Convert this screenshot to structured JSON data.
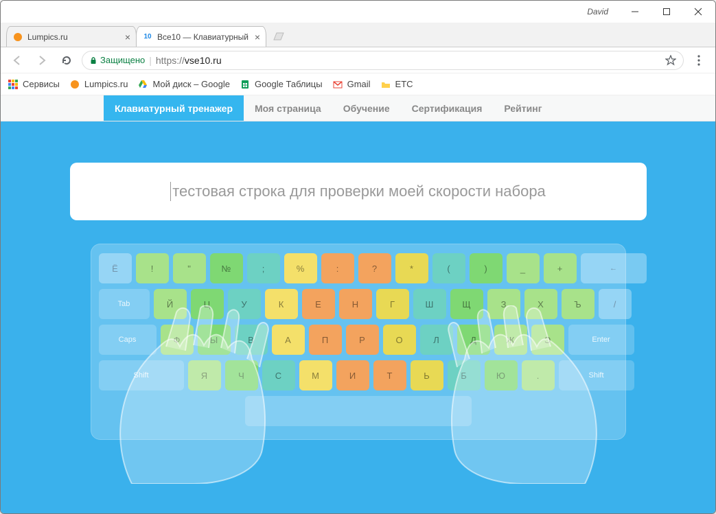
{
  "window": {
    "user": "David"
  },
  "tabs": [
    {
      "title": "Lumpics.ru",
      "active": false
    },
    {
      "title": "Все10 — Клавиатурный",
      "active": true
    }
  ],
  "address": {
    "secure_label": "Защищено",
    "scheme": "https://",
    "host": "vse10.ru"
  },
  "bookmarks": [
    {
      "label": "Сервисы"
    },
    {
      "label": "Lumpics.ru"
    },
    {
      "label": "Мой диск – Google"
    },
    {
      "label": "Google Таблицы"
    },
    {
      "label": "Gmail"
    },
    {
      "label": "ETC"
    }
  ],
  "sitenav": [
    {
      "label": "Клавиатурный тренажер",
      "active": true
    },
    {
      "label": "Моя страница"
    },
    {
      "label": "Обучение"
    },
    {
      "label": "Сертификация"
    },
    {
      "label": "Рейтинг"
    }
  ],
  "typing_text": "тестовая строка для проверки моей скорости набора",
  "keyboard": {
    "row1": [
      "Ё",
      "!",
      "\"",
      "№",
      ";",
      "%",
      ":",
      "?",
      "*",
      "(",
      ")",
      "_",
      "+",
      "←"
    ],
    "row2": [
      "Tab",
      "Й",
      "Ц",
      "У",
      "К",
      "Е",
      "Н",
      "Г",
      "Ш",
      "Щ",
      "З",
      "Х",
      "Ъ",
      "/"
    ],
    "row3": [
      "Caps",
      "Ф",
      "Ы",
      "В",
      "А",
      "П",
      "Р",
      "О",
      "Л",
      "Д",
      "Ж",
      "Э",
      "Enter"
    ],
    "row4": [
      "Shift",
      "Я",
      "Ч",
      "С",
      "М",
      "И",
      "Т",
      "Ь",
      "Б",
      "Ю",
      ".",
      "Shift"
    ]
  },
  "color_map": {
    "row1": [
      "gray",
      "c-green1",
      "c-green1",
      "c-green2",
      "c-teal",
      "c-yellow",
      "c-orange",
      "c-orange",
      "c-yellow2",
      "c-teal",
      "c-green2",
      "c-green1",
      "c-green1",
      "gray"
    ],
    "row2": [
      "clear",
      "c-green1",
      "c-green2",
      "c-teal",
      "c-yellow",
      "c-orange",
      "c-orange",
      "c-yellow2",
      "c-teal",
      "c-green2",
      "c-green1",
      "c-green1",
      "c-green1",
      "gray"
    ],
    "row3": [
      "clear",
      "c-green1",
      "c-green2",
      "c-teal",
      "c-yellow",
      "c-orange",
      "c-orange",
      "c-yellow2",
      "c-teal",
      "c-green2",
      "c-green1",
      "c-green1",
      "clear"
    ],
    "row4": [
      "clear",
      "c-green1",
      "c-green2",
      "c-teal",
      "c-yellow",
      "c-orange",
      "c-orange",
      "c-yellow2",
      "c-teal",
      "c-green2",
      "c-green1",
      "clear"
    ]
  }
}
